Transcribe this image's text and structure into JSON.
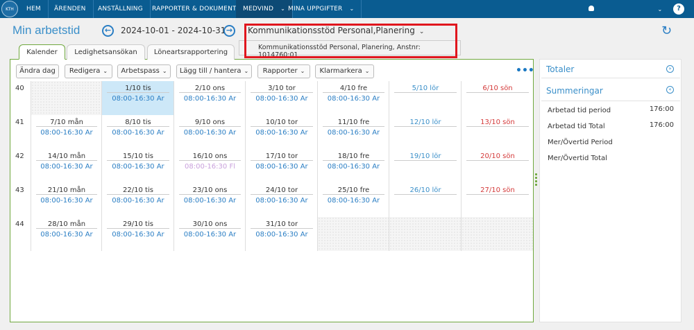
{
  "nav": {
    "logo_text": "KTH",
    "items": [
      "HEM",
      "ÄRENDEN",
      "ANSTÄLLNING",
      "RAPPORTER & DOKUMENT",
      "MEDVIND",
      "MINA UPPGIFTER"
    ],
    "caret": "⌄",
    "user_icon": "user-icon",
    "help": "?"
  },
  "header": {
    "title": "Min arbetstid",
    "period": "2024-10-01 - 2024-10-31",
    "unit_selected": "Kommunikationsstöd Personal,Planering",
    "unit_option": "Kommunikationsstöd Personal, Planering, Anstnr: 1014760:01",
    "prev_glyph": "←",
    "next_glyph": "→",
    "refresh_glyph": "↻"
  },
  "tabs": [
    "Kalender",
    "Ledighetsansökan",
    "Löneartsrapportering"
  ],
  "toolbar": {
    "change_day": "Ändra dag",
    "edit": "Redigera",
    "shifts": "Arbetspass",
    "add": "Lägg till / hantera",
    "reports": "Rapporter",
    "mark_done": "Klarmarkera",
    "more": "•••"
  },
  "calendar": {
    "weeks": [
      {
        "num": "40",
        "days": [
          {
            "label": "",
            "shift": "",
            "empty": true
          },
          {
            "label": "1/10 tis",
            "shift": "08:00-16:30  Ar",
            "selected": true
          },
          {
            "label": "2/10 ons",
            "shift": "08:00-16:30  Ar"
          },
          {
            "label": "3/10 tor",
            "shift": "08:00-16:30  Ar"
          },
          {
            "label": "4/10 fre",
            "shift": "08:00-16:30  Ar"
          },
          {
            "label": "5/10 lör",
            "shift": "",
            "kind": "sat"
          },
          {
            "label": "6/10 sön",
            "shift": "",
            "kind": "sun"
          }
        ]
      },
      {
        "num": "41",
        "days": [
          {
            "label": "7/10 mån",
            "shift": "08:00-16:30  Ar"
          },
          {
            "label": "8/10 tis",
            "shift": "08:00-16:30  Ar"
          },
          {
            "label": "9/10 ons",
            "shift": "08:00-16:30  Ar"
          },
          {
            "label": "10/10 tor",
            "shift": "08:00-16:30  Ar"
          },
          {
            "label": "11/10 fre",
            "shift": "08:00-16:30  Ar"
          },
          {
            "label": "12/10 lör",
            "shift": "",
            "kind": "sat"
          },
          {
            "label": "13/10 sön",
            "shift": "",
            "kind": "sun"
          }
        ]
      },
      {
        "num": "42",
        "days": [
          {
            "label": "14/10 mån",
            "shift": "08:00-16:30  Ar"
          },
          {
            "label": "15/10 tis",
            "shift": "08:00-16:30  Ar"
          },
          {
            "label": "16/10 ons",
            "shift": "08:00-16:30  Fl",
            "shift_color": "#c9a0dc"
          },
          {
            "label": "17/10 tor",
            "shift": "08:00-16:30  Ar"
          },
          {
            "label": "18/10 fre",
            "shift": "08:00-16:30  Ar"
          },
          {
            "label": "19/10 lör",
            "shift": "",
            "kind": "sat"
          },
          {
            "label": "20/10 sön",
            "shift": "",
            "kind": "sun"
          }
        ]
      },
      {
        "num": "43",
        "days": [
          {
            "label": "21/10 mån",
            "shift": "08:00-16:30  Ar"
          },
          {
            "label": "22/10 tis",
            "shift": "08:00-16:30  Ar"
          },
          {
            "label": "23/10 ons",
            "shift": "08:00-16:30  Ar"
          },
          {
            "label": "24/10 tor",
            "shift": "08:00-16:30  Ar"
          },
          {
            "label": "25/10 fre",
            "shift": "08:00-16:30  Ar"
          },
          {
            "label": "26/10 lör",
            "shift": "",
            "kind": "sat"
          },
          {
            "label": "27/10 sön",
            "shift": "",
            "kind": "sun"
          }
        ]
      },
      {
        "num": "44",
        "days": [
          {
            "label": "28/10 mån",
            "shift": "08:00-16:30  Ar"
          },
          {
            "label": "29/10 tis",
            "shift": "08:00-16:30  Ar"
          },
          {
            "label": "30/10 ons",
            "shift": "08:00-16:30  Ar"
          },
          {
            "label": "31/10 tor",
            "shift": "08:00-16:30  Ar"
          },
          {
            "label": "",
            "shift": "",
            "empty": true
          },
          {
            "label": "",
            "shift": "",
            "empty": true
          },
          {
            "label": "",
            "shift": "",
            "empty": true
          }
        ]
      }
    ]
  },
  "side": {
    "totals_title": "Totaler",
    "sums_title": "Summeringar",
    "rows": [
      {
        "label": "Arbetad tid period",
        "value": "176:00"
      },
      {
        "label": "Arbetad tid Total",
        "value": "176:00"
      },
      {
        "label": "Mer/Övertid Period",
        "value": ""
      },
      {
        "label": "Mer/Övertid Total",
        "value": ""
      }
    ]
  },
  "colors": {
    "nav_bg": "#0a5c91",
    "accent": "#3a8fc9",
    "sunday": "#d43a3a",
    "selected_day": "#cde8f8",
    "highlight_box": "#e0161e",
    "tab_border": "#6fa83e"
  }
}
